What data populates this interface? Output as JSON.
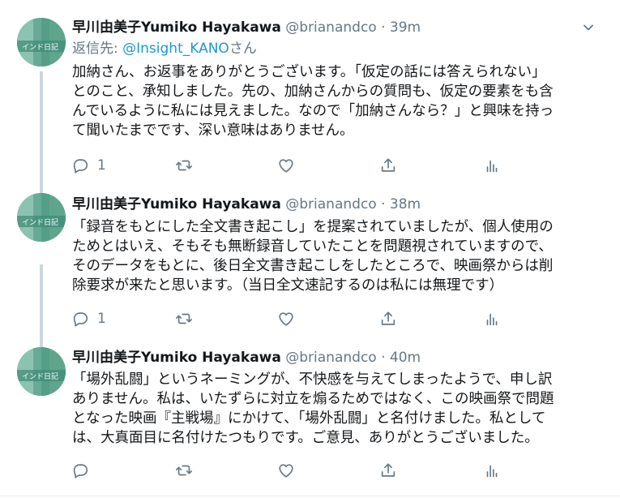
{
  "tweets": [
    {
      "name": "早川由美子Yumiko Hayakawa",
      "handle": "@brianandco",
      "dot": "·",
      "time": "39m",
      "reply_label": "返信先:",
      "reply_mention": "@Insight_KANO",
      "reply_suffix": "さん",
      "lines": [
        "加納さん、お返事をありがとうございます。「仮定の話には答えられない」",
        "とのこと、承知しました。先の、加納さんからの質問も、仮定の要素をも含",
        "んでいるように私には見えました。なので「加納さんなら？」と興味を持っ",
        "て聞いたまでです、深い意味はありません。"
      ],
      "reply_count": "1"
    },
    {
      "name": "早川由美子Yumiko Hayakawa",
      "handle": "@brianandco",
      "dot": "·",
      "time": "38m",
      "lines": [
        "「録音をもとにした全文書き起こし」を提案されていましたが、個人使用の",
        "ためとはいえ、そもそも無断録音していたことを問題視されていますので、",
        "そのデータをもとに、後日全文書き起こしをしたところで、映画祭からは削",
        "除要求が来たと思います。（当日全文速記するのは私には無理です）"
      ],
      "reply_count": "1"
    },
    {
      "name": "早川由美子Yumiko Hayakawa",
      "handle": "@brianandco",
      "dot": "·",
      "time": "40m",
      "lines": [
        "「場外乱闘」というネーミングが、不快感を与えてしまったようで、申し訳",
        "ありません。私は、いたずらに対立を煽るためではなく、この映画祭で問題",
        "となった映画『主戦場』にかけて、「場外乱闘」と名付けました。私として",
        "は、大真面目に名付けたつもりです。ご意見、ありがとうございました。"
      ],
      "reply_count": ""
    }
  ],
  "avatar_text": "インド日記",
  "colors": {
    "accent": "#1b95e0",
    "muted": "#657786",
    "text": "#14171a",
    "thread_line": "#ccd6dd"
  },
  "icons": {
    "reply": "reply-icon",
    "retweet": "retweet-icon",
    "like": "heart-icon",
    "share": "share-icon",
    "analytics": "analytics-icon",
    "caret": "chevron-down-icon"
  }
}
